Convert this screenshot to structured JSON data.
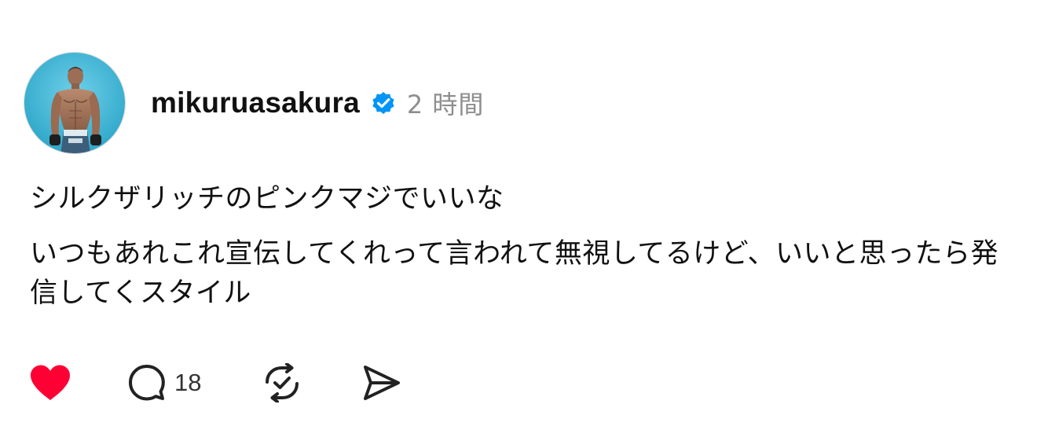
{
  "post": {
    "username": "mikuruasakura",
    "verified_icon": "verified-badge-icon",
    "time_ago": "2 時間",
    "paragraphs": [
      "シルクザリッチのピンクマジでいいな",
      "いつもあれこれ宣伝してくれって言われて無視してるけど、いいと思ったら発信してくスタイル"
    ]
  },
  "actions": {
    "like": {
      "icon": "heart-icon",
      "state": "liked",
      "color": "#ff0034"
    },
    "reply": {
      "icon": "comment-icon",
      "count": "18"
    },
    "repost": {
      "icon": "repost-icon"
    },
    "share": {
      "icon": "send-icon"
    }
  },
  "colors": {
    "verified": "#0095f6",
    "meta_text": "#8e8e8e",
    "text": "#111111"
  }
}
